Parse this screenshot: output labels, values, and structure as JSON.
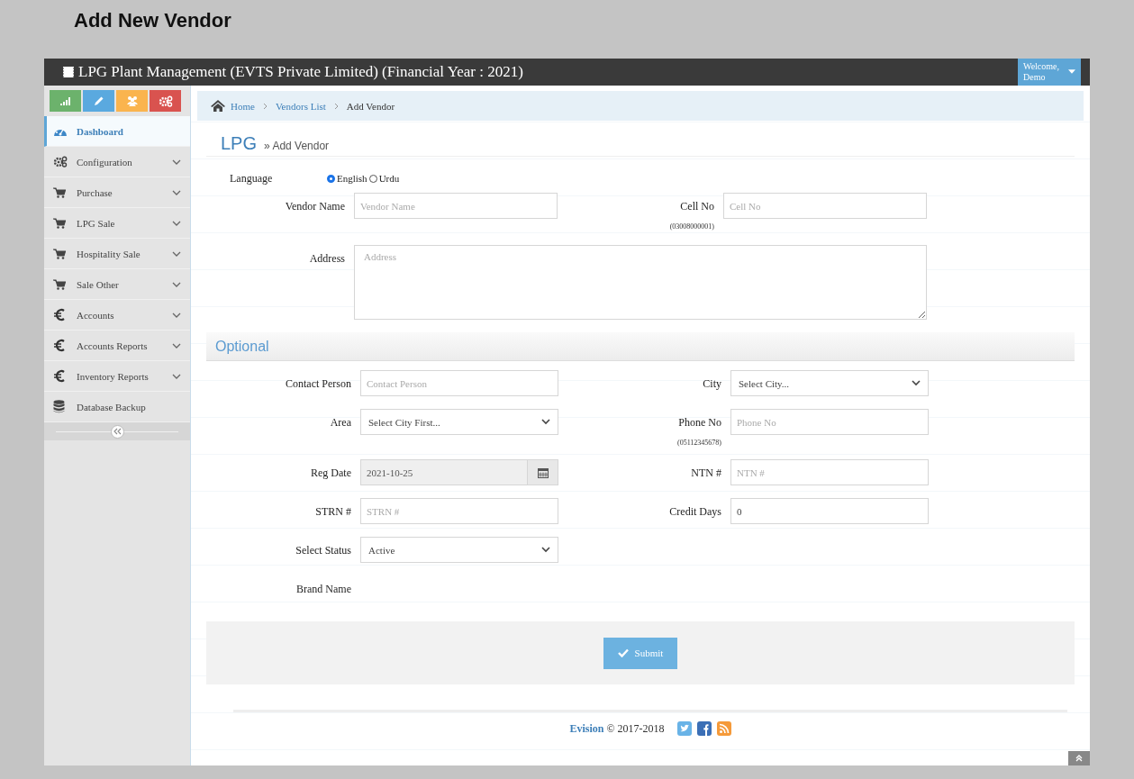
{
  "page_title": "Add New Vendor",
  "header": {
    "title": "LPG Plant Management (EVTS Private Limited) (Financial Year : 2021)",
    "user_greeting": "Welcome,",
    "user_name": "Demo"
  },
  "sidebar": {
    "shortcut_buttons": [
      {
        "kind": "chart",
        "color": "#6cb26c"
      },
      {
        "kind": "pencil",
        "color": "#5aa9df"
      },
      {
        "kind": "users",
        "color": "#fab44e"
      },
      {
        "kind": "gears",
        "color": "#d9534f"
      }
    ],
    "items": [
      {
        "label": "Dashboard",
        "kind": "dashboard",
        "selected": true,
        "expandable": false
      },
      {
        "label": "Configuration",
        "kind": "gears",
        "selected": false,
        "expandable": true
      },
      {
        "label": "Purchase",
        "kind": "cart",
        "selected": false,
        "expandable": true
      },
      {
        "label": "LPG Sale",
        "kind": "cart",
        "selected": false,
        "expandable": true
      },
      {
        "label": "Hospitality Sale",
        "kind": "cart",
        "selected": false,
        "expandable": true
      },
      {
        "label": "Sale Other",
        "kind": "cart",
        "selected": false,
        "expandable": true
      },
      {
        "label": "Accounts",
        "kind": "euro",
        "selected": false,
        "expandable": true
      },
      {
        "label": "Accounts Reports",
        "kind": "euro",
        "selected": false,
        "expandable": true
      },
      {
        "label": "Inventory Reports",
        "kind": "euro",
        "selected": false,
        "expandable": true
      },
      {
        "label": "Database Backup",
        "kind": "database",
        "selected": false,
        "expandable": false
      }
    ]
  },
  "breadcrumb": [
    {
      "label": "Home",
      "kind": "home"
    },
    {
      "label": "Vendors List",
      "kind": "link"
    },
    {
      "label": "Add Vendor",
      "kind": "current"
    }
  ],
  "page_header": {
    "title": "LPG",
    "subtitle": "» Add Vendor"
  },
  "language": {
    "label": "Language",
    "options": [
      {
        "label": "English",
        "selected": true
      },
      {
        "label": "Urdu",
        "selected": false
      }
    ]
  },
  "main_rows": [
    [
      {
        "label": "Vendor Name",
        "kind": "text",
        "placeholder": "Vendor Name"
      },
      {
        "label": "Cell No",
        "hint": "(03008000001)",
        "kind": "text",
        "placeholder": "Cell No"
      }
    ],
    [
      {
        "label": "Address",
        "kind": "textarea",
        "placeholder": "Address"
      }
    ]
  ],
  "optional": {
    "title": "Optional",
    "rows": [
      [
        {
          "label": "Contact Person",
          "kind": "text",
          "placeholder": "Contact Person"
        },
        {
          "label": "City",
          "kind": "select",
          "value": "Select City..."
        }
      ],
      [
        {
          "label": "Area",
          "kind": "select",
          "value": "Select City First..."
        },
        {
          "label": "Phone No",
          "hint": "(05112345678)",
          "kind": "text",
          "placeholder": "Phone No"
        }
      ],
      [
        {
          "label": "Reg Date",
          "kind": "date",
          "value": "2021-10-25"
        },
        {
          "label": "NTN #",
          "kind": "text",
          "placeholder": "NTN #"
        }
      ],
      [
        {
          "label": "STRN #",
          "kind": "text",
          "placeholder": "STRN #"
        },
        {
          "label": "Credit Days",
          "kind": "text",
          "value": "0"
        }
      ],
      [
        {
          "label": "Select Status",
          "kind": "select",
          "value": "Active"
        }
      ],
      [
        {
          "label": "Brand Name",
          "kind": "none"
        }
      ]
    ]
  },
  "submit": {
    "label": "Submit"
  },
  "footer": {
    "brand": "Evision",
    "text": "© 2017-2018",
    "social": [
      {
        "kind": "twitter",
        "color": "#69b3e7"
      },
      {
        "kind": "facebook",
        "color": "#3b6fb6"
      },
      {
        "kind": "rss",
        "color": "#f59a3a"
      }
    ]
  }
}
